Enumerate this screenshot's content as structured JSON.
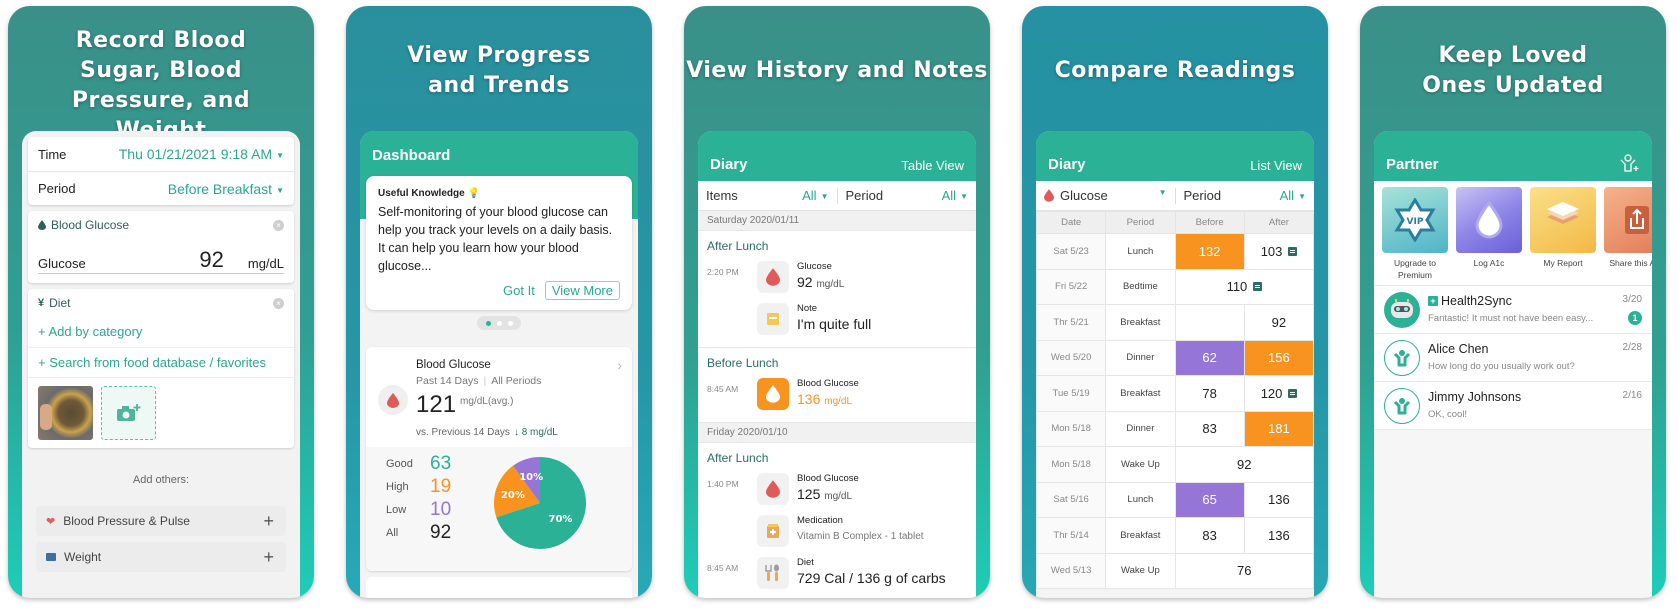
{
  "colors": {
    "brand_teal": "#2bb296",
    "accent_teal_text": "#2aa78f",
    "high_orange": "#f7931e",
    "low_purple": "#9575d6",
    "good_green": "#2bb296"
  },
  "panels": [
    {
      "headline": "Record Blood Sugar, Blood Pressure, and Weight",
      "form": {
        "time_label": "Time",
        "time_value": "Thu 01/21/2021 9:18 AM",
        "period_label": "Period",
        "period_value": "Before Breakfast",
        "glucose_section": "Blood Glucose",
        "glucose_label": "Glucose",
        "glucose_value": "92",
        "glucose_unit": "mg/dL",
        "diet_section": "Diet",
        "add_by_category": "+ Add by category",
        "search_food": "+ Search from food database / favorites",
        "add_others": "Add others:",
        "others": [
          {
            "label": "Blood Pressure & Pulse",
            "icon": "heart-pulse-icon"
          },
          {
            "label": "Weight",
            "icon": "scale-icon"
          }
        ]
      }
    },
    {
      "headline": "View Progress and Trends",
      "appbar_title": "Dashboard",
      "knowledge": {
        "title": "Useful Knowledge",
        "body": "Self-monitoring of your blood glucose can help you track your levels on a daily basis. It can help you learn how your blood glucose...",
        "got_it": "Got It",
        "view_more": "View More"
      },
      "carousel": {
        "pages": 3,
        "active": 1
      },
      "summary": {
        "title": "Blood Glucose",
        "range": "Past 14 Days",
        "periods": "All Periods",
        "avg": "121",
        "avg_unit": "mg/dL(avg.)",
        "compare": "vs. Previous 14 Days",
        "delta": "8 mg/dL",
        "delta_direction": "down",
        "stats": [
          {
            "label": "Good",
            "value": "63",
            "color": "#2bb296"
          },
          {
            "label": "High",
            "value": "19",
            "color": "#f7931e"
          },
          {
            "label": "Low",
            "value": "10",
            "color": "#9575d6"
          },
          {
            "label": "All",
            "value": "92",
            "color": "#222222"
          }
        ]
      },
      "chart_data": {
        "type": "pie",
        "title": "",
        "labels": [
          "Good",
          "High",
          "Low"
        ],
        "values": [
          70,
          20,
          10
        ],
        "display_labels": [
          "70%",
          "20%",
          "10%"
        ],
        "colors": [
          "#2bb296",
          "#f7931e",
          "#9575d6"
        ]
      }
    },
    {
      "headline": "View History and Notes",
      "appbar_title": "Diary",
      "appbar_action": "Table View",
      "filter": {
        "items_label": "Items",
        "items_value": "All",
        "period_label": "Period",
        "period_value": "All"
      },
      "days": [
        {
          "date": "Saturday 2020/01/11",
          "groups": [
            {
              "period": "After Lunch",
              "entries": [
                {
                  "time": "2:20 PM",
                  "icon": "blood-drop-icon",
                  "name": "Glucose",
                  "value": "92",
                  "unit": "mg/dL"
                },
                {
                  "time": "",
                  "icon": "note-icon",
                  "name": "Note",
                  "value": "I'm quite full",
                  "unit": ""
                }
              ]
            },
            {
              "period": "Before Lunch",
              "entries": [
                {
                  "time": "8:45 AM",
                  "icon": "blood-drop-icon",
                  "name": "Blood Glucose",
                  "value": "136",
                  "unit": "mg/dL",
                  "status": "high"
                }
              ]
            }
          ]
        },
        {
          "date": "Friday 2020/01/10",
          "groups": [
            {
              "period": "After Lunch",
              "entries": [
                {
                  "time": "1:40 PM",
                  "icon": "blood-drop-icon",
                  "name": "Blood Glucose",
                  "value": "125",
                  "unit": "mg/dL"
                },
                {
                  "time": "",
                  "icon": "medication-icon",
                  "name": "Medication",
                  "sub": "Vitamin B Complex - 1 tablet"
                },
                {
                  "time": "8:45 AM",
                  "icon": "utensils-icon",
                  "name": "Diet",
                  "value": "729 Cal / 136 g of carbs",
                  "unit": ""
                }
              ]
            }
          ]
        }
      ]
    },
    {
      "headline": "Compare Readings",
      "appbar_title": "Diary",
      "appbar_action": "List View",
      "filter": {
        "items_value": "Glucose",
        "period_label": "Period",
        "period_value": "All"
      },
      "table": {
        "headers": [
          "Date",
          "Period",
          "Before",
          "After"
        ],
        "rows": [
          {
            "date": "Sat 5/23",
            "period": "Lunch",
            "before": "132",
            "before_status": "high",
            "after": "103",
            "after_note": true
          },
          {
            "date": "Fri 5/22",
            "period": "Bedtime",
            "single": "110",
            "single_note": true
          },
          {
            "date": "Thr 5/21",
            "period": "Breakfast",
            "before": "",
            "after": "92"
          },
          {
            "date": "Wed 5/20",
            "period": "Dinner",
            "before": "62",
            "before_status": "low",
            "after": "156",
            "after_status": "high"
          },
          {
            "date": "Tue 5/19",
            "period": "Breakfast",
            "before": "78",
            "after": "120",
            "after_note": true
          },
          {
            "date": "Mon 5/18",
            "period": "Dinner",
            "before": "83",
            "after": "181",
            "after_status": "high"
          },
          {
            "date": "Mon 5/18",
            "period": "Wake Up",
            "single": "92"
          },
          {
            "date": "Sat 5/16",
            "period": "Lunch",
            "before": "65",
            "before_status": "low",
            "after": "136"
          },
          {
            "date": "Thr 5/14",
            "period": "Breakfast",
            "before": "83",
            "after": "136"
          },
          {
            "date": "Wed 5/13",
            "period": "Wake Up",
            "single": "76"
          }
        ]
      }
    },
    {
      "headline": "Keep Loved Ones Updated",
      "appbar_title": "Partner",
      "features": [
        {
          "label": "Upgrade to Premium",
          "icon": "vip-star-icon"
        },
        {
          "label": "Log A1c",
          "icon": "drop-icon"
        },
        {
          "label": "My Report",
          "icon": "layers-icon"
        },
        {
          "label": "Share this App",
          "icon": "share-icon"
        }
      ],
      "chats": [
        {
          "name": "Health2Sync",
          "message": "Fantastic! It must not have been easy...",
          "date": "3/20",
          "unread": "1",
          "bot": true
        },
        {
          "name": "Alice Chen",
          "message": "How long do you usually work out?",
          "date": "2/28"
        },
        {
          "name": "Jimmy Johnsons",
          "message": "OK, cool!",
          "date": "2/16"
        }
      ]
    }
  ]
}
